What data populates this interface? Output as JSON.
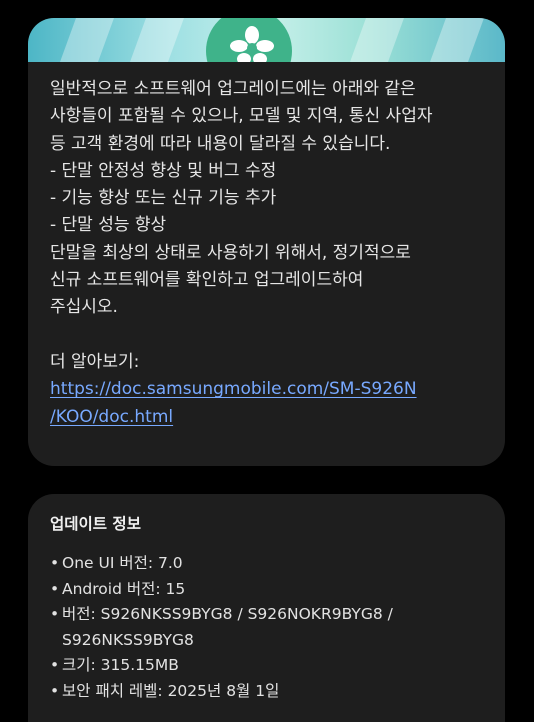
{
  "release_notes": {
    "paragraph_lines": [
      "일반적으로 소프트웨어 업그레이드에는 아래와 같은",
      "사항들이 포함될 수 있으나, 모델 및 지역, 통신 사업자",
      "등 고객 환경에 따라 내용이 달라질 수 있습니다."
    ],
    "items": [
      " - 단말 안정성 향상 및 버그 수정",
      " - 기능 향상 또는 신규 기능 추가",
      " - 단말 성능 향상"
    ],
    "closing_lines": [
      "단말을 최상의 상태로 사용하기 위해서, 정기적으로",
      "신규 소프트웨어를 확인하고 업그레이드하여",
      "주십시오."
    ],
    "learn_more_label": "더 알아보기:",
    "link_lines": [
      "https://doc.samsungmobile.com/SM-S926N",
      "/KOO/doc.html"
    ]
  },
  "update_info": {
    "title": "업데이트 정보",
    "bullet": "•",
    "one_ui": "One UI 버전: 7.0",
    "android": "Android 버전: 15",
    "build_line1": "버전: S926NKSS9BYG8 / S926NOKR9BYG8 /",
    "build_line2": "S926NKSS9BYG8",
    "size": "크기: 315.15MB",
    "security_patch": "보안 패치 레벨: 2025년 8월 1일"
  },
  "colors": {
    "background": "#000000",
    "card": "#1e1e1e",
    "link": "#78a9ff",
    "banner_accent": "#3fb38a"
  }
}
